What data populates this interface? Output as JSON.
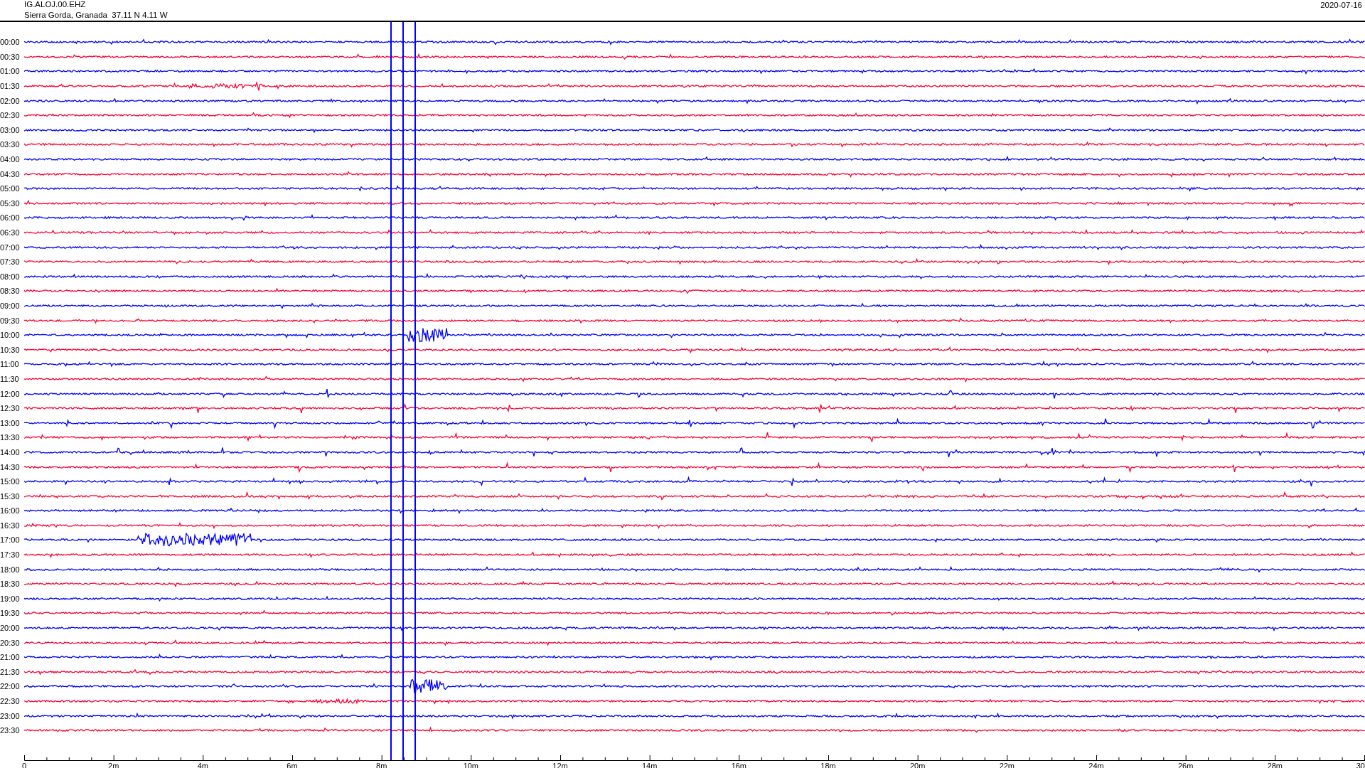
{
  "header": {
    "station": "IG.ALOJ.00.EHZ",
    "location": "Sierra Gorda, Granada  37.11 N 4.11 W",
    "date": "2020-07-16"
  },
  "rows": [
    {
      "time": "00:00",
      "color": "#0000ff"
    },
    {
      "time": "00:30",
      "color": "#ff0033"
    },
    {
      "time": "01:00",
      "color": "#0000ff"
    },
    {
      "time": "01:30",
      "color": "#ff0033"
    },
    {
      "time": "02:00",
      "color": "#0000ff"
    },
    {
      "time": "02:30",
      "color": "#ff0033"
    },
    {
      "time": "03:00",
      "color": "#0000ff"
    },
    {
      "time": "03:30",
      "color": "#ff0033"
    },
    {
      "time": "04:00",
      "color": "#0000ff"
    },
    {
      "time": "04:30",
      "color": "#ff0033"
    },
    {
      "time": "05:00",
      "color": "#0000ff"
    },
    {
      "time": "05:30",
      "color": "#ff0033"
    },
    {
      "time": "06:00",
      "color": "#0000ff"
    },
    {
      "time": "06:30",
      "color": "#ff0033"
    },
    {
      "time": "07:00",
      "color": "#0000ff"
    },
    {
      "time": "07:30",
      "color": "#ff0033"
    },
    {
      "time": "08:00",
      "color": "#0000ff"
    },
    {
      "time": "08:30",
      "color": "#ff0033"
    },
    {
      "time": "09:00",
      "color": "#0000ff"
    },
    {
      "time": "09:30",
      "color": "#ff0033"
    },
    {
      "time": "10:00",
      "color": "#0000ff"
    },
    {
      "time": "10:30",
      "color": "#ff0033"
    },
    {
      "time": "11:00",
      "color": "#0000ff"
    },
    {
      "time": "11:30",
      "color": "#ff0033"
    },
    {
      "time": "12:00",
      "color": "#0000ff"
    },
    {
      "time": "12:30",
      "color": "#ff0033"
    },
    {
      "time": "13:00",
      "color": "#0000ff"
    },
    {
      "time": "13:30",
      "color": "#ff0033"
    },
    {
      "time": "14:00",
      "color": "#0000ff"
    },
    {
      "time": "14:30",
      "color": "#ff0033"
    },
    {
      "time": "15:00",
      "color": "#0000ff"
    },
    {
      "time": "15:30",
      "color": "#ff0033"
    },
    {
      "time": "16:00",
      "color": "#0000ff"
    },
    {
      "time": "16:30",
      "color": "#ff0033"
    },
    {
      "time": "17:00",
      "color": "#0000ff"
    },
    {
      "time": "17:30",
      "color": "#ff0033"
    },
    {
      "time": "18:00",
      "color": "#0000ff"
    },
    {
      "time": "18:30",
      "color": "#ff0033"
    },
    {
      "time": "19:00",
      "color": "#0000ff"
    },
    {
      "time": "19:30",
      "color": "#ff0033"
    },
    {
      "time": "20:00",
      "color": "#0000ff"
    },
    {
      "time": "20:30",
      "color": "#ff0033"
    },
    {
      "time": "21:00",
      "color": "#0000ff"
    },
    {
      "time": "21:30",
      "color": "#ff0033"
    },
    {
      "time": "22:00",
      "color": "#0000ff"
    },
    {
      "time": "22:30",
      "color": "#ff0033"
    },
    {
      "time": "23:00",
      "color": "#0000ff"
    },
    {
      "time": "23:30",
      "color": "#ff0033"
    }
  ],
  "axis": {
    "labels": [
      "0",
      "2m",
      "4m",
      "6m",
      "8m",
      "10m",
      "12m",
      "14m",
      "16m",
      "18m",
      "20m",
      "22m",
      "24m",
      "26m",
      "28m",
      "30"
    ]
  }
}
